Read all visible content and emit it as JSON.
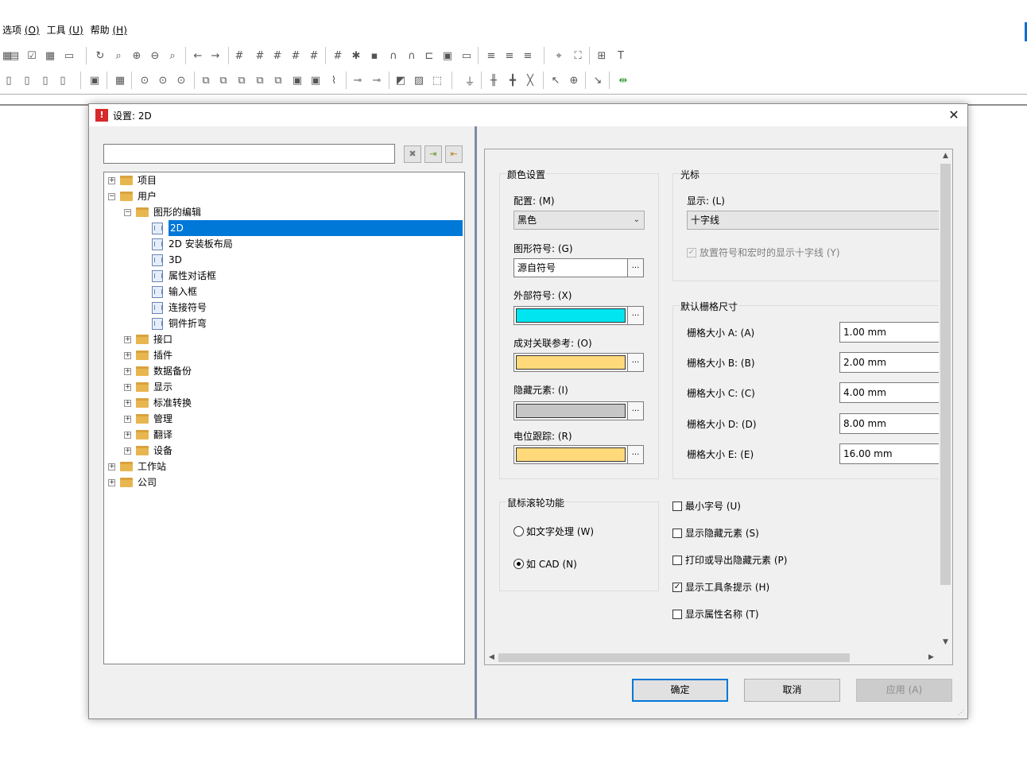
{
  "menu": [
    {
      "label": "选项",
      "key": "(O)"
    },
    {
      "label": "工具",
      "key": "(U)"
    },
    {
      "label": "帮助",
      "key": "(H)"
    }
  ],
  "dialog": {
    "title": "设置: 2D",
    "close_glyph": "✕"
  },
  "tree": [
    {
      "label": "项目",
      "level": 0,
      "type": "folder",
      "exp": "+"
    },
    {
      "label": "用户",
      "level": 0,
      "type": "folder",
      "exp": "−"
    },
    {
      "label": "图形的编辑",
      "level": 1,
      "type": "folder",
      "exp": "−"
    },
    {
      "label": "2D",
      "level": 2,
      "type": "doc",
      "selected": true
    },
    {
      "label": "2D 安装板布局",
      "level": 2,
      "type": "doc"
    },
    {
      "label": "3D",
      "level": 2,
      "type": "doc"
    },
    {
      "label": "属性对话框",
      "level": 2,
      "type": "doc"
    },
    {
      "label": "输入框",
      "level": 2,
      "type": "doc"
    },
    {
      "label": "连接符号",
      "level": 2,
      "type": "doc"
    },
    {
      "label": "铜件折弯",
      "level": 2,
      "type": "doc"
    },
    {
      "label": "接口",
      "level": 1,
      "type": "folder",
      "exp": "+"
    },
    {
      "label": "插件",
      "level": 1,
      "type": "folder",
      "exp": "+"
    },
    {
      "label": "数据备份",
      "level": 1,
      "type": "folder",
      "exp": "+"
    },
    {
      "label": "显示",
      "level": 1,
      "type": "folder",
      "exp": "+"
    },
    {
      "label": "标准转换",
      "level": 1,
      "type": "folder",
      "exp": "+"
    },
    {
      "label": "管理",
      "level": 1,
      "type": "folder",
      "exp": "+"
    },
    {
      "label": "翻译",
      "level": 1,
      "type": "folder",
      "exp": "+"
    },
    {
      "label": "设备",
      "level": 1,
      "type": "folder",
      "exp": "+"
    },
    {
      "label": "工作站",
      "level": 0,
      "type": "folder",
      "exp": "+"
    },
    {
      "label": "公司",
      "level": 0,
      "type": "folder",
      "exp": "+"
    }
  ],
  "color_settings": {
    "title": "颜色设置",
    "config_label": "配置: (M)",
    "config_value": "黑色",
    "symbol_label": "图形符号: (G)",
    "symbol_value": "源自符号",
    "external_label": "外部符号: (X)",
    "external_color": "#00e5f0",
    "pair_label": "成对关联参考: (O)",
    "pair_color": "#ffd97a",
    "hidden_label": "隐藏元素: (I)",
    "hidden_color": "#c6c6c6",
    "potential_label": "电位跟踪: (R)",
    "potential_color": "#ffd97a",
    "dots": "..."
  },
  "cursor": {
    "title": "光标",
    "display_label": "显示: (L)",
    "display_value": "十字线",
    "crosshair_check": "放置符号和宏时的显示十字线 (Y)"
  },
  "grid": {
    "title": "默认栅格尺寸",
    "rows": [
      {
        "label": "栅格大小 A: (A)",
        "value": "1.00 mm"
      },
      {
        "label": "栅格大小 B: (B)",
        "value": "2.00 mm"
      },
      {
        "label": "栅格大小 C: (C)",
        "value": "4.00 mm"
      },
      {
        "label": "栅格大小 D: (D)",
        "value": "8.00 mm"
      },
      {
        "label": "栅格大小 E: (E)",
        "value": "16.00 mm"
      }
    ]
  },
  "wheel": {
    "title": "鼠标滚轮功能",
    "opt1": "如文字处理 (W)",
    "opt2": "如 CAD  (N)",
    "selected": 2
  },
  "checks": [
    {
      "label": "最小字号 (U)",
      "checked": false
    },
    {
      "label": "显示隐藏元素 (S)",
      "checked": false
    },
    {
      "label": "打印或导出隐藏元素 (P)",
      "checked": false
    },
    {
      "label": "显示工具条提示 (H)",
      "checked": true
    },
    {
      "label": "显示属性名称 (T)",
      "checked": false
    }
  ],
  "buttons": {
    "ok": "确定",
    "cancel": "取消",
    "apply": "应用 (A)"
  },
  "glyphs": {
    "check": "✓",
    "up": "▲",
    "down": "▼",
    "left": "◀",
    "right": "▶",
    "combo_arrow": "⌄",
    "clear": "✖",
    "import": "⇥",
    "export": "⇤",
    "grip": "⋰"
  }
}
